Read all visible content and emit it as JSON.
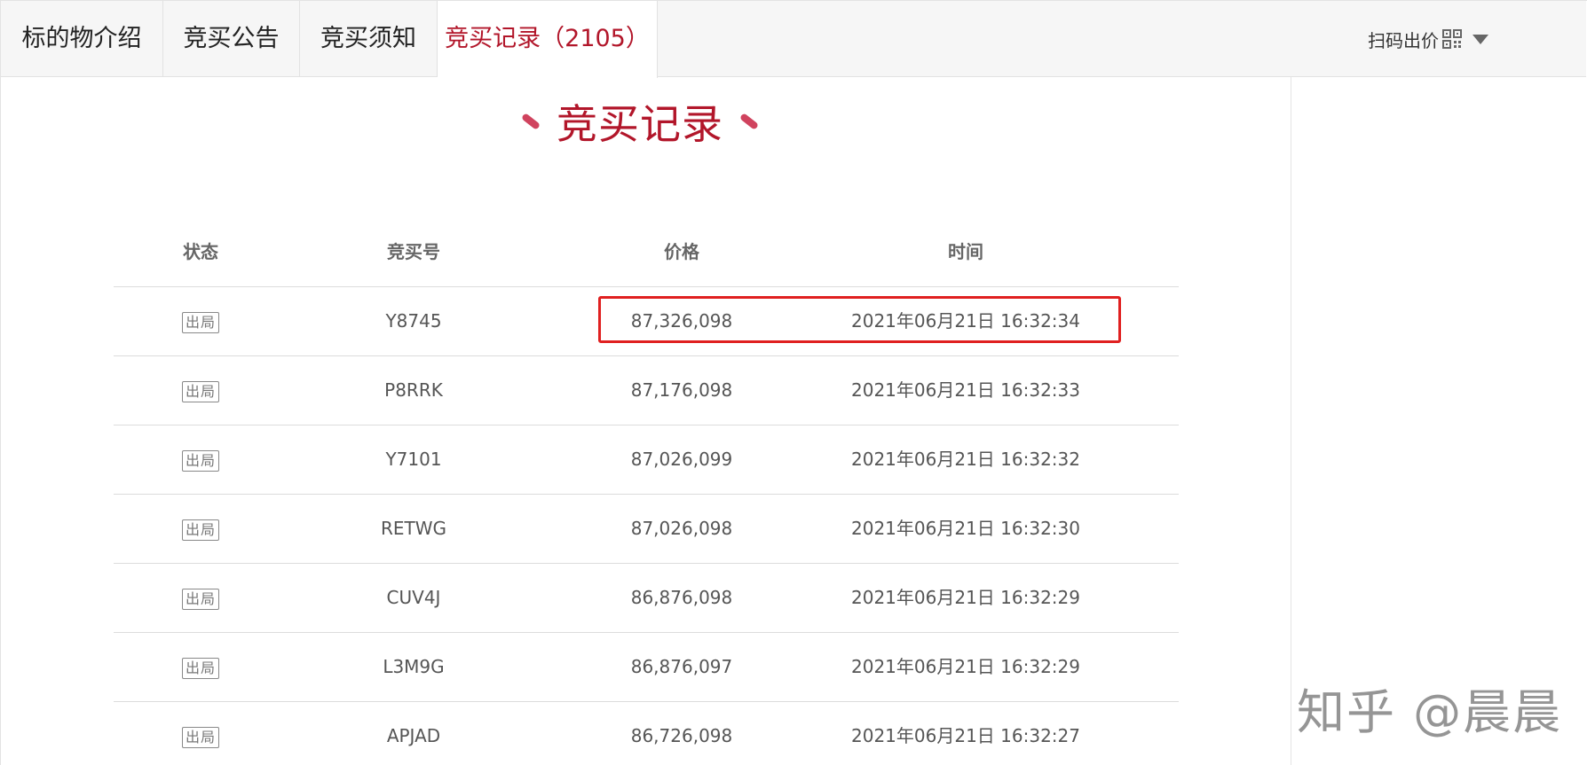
{
  "tabs": [
    {
      "label": "标的物介绍"
    },
    {
      "label": "竞买公告"
    },
    {
      "label": "竞买须知"
    },
    {
      "label": "竞买记录（2105）"
    }
  ],
  "scan_bid": {
    "label": "扫码出价",
    "icon": "qr-code-icon"
  },
  "section_title": "竞买记录",
  "table": {
    "headers": [
      "状态",
      "竞买号",
      "价格",
      "时间"
    ],
    "rows": [
      {
        "status": "出局",
        "bid_no": "Y8745",
        "price": "87,326,098",
        "time": "2021年06月21日 16:32:34"
      },
      {
        "status": "出局",
        "bid_no": "P8RRK",
        "price": "87,176,098",
        "time": "2021年06月21日 16:32:33"
      },
      {
        "status": "出局",
        "bid_no": "Y7101",
        "price": "87,026,099",
        "time": "2021年06月21日 16:32:32"
      },
      {
        "status": "出局",
        "bid_no": "RETWG",
        "price": "87,026,098",
        "time": "2021年06月21日 16:32:30"
      },
      {
        "status": "出局",
        "bid_no": "CUV4J",
        "price": "86,876,098",
        "time": "2021年06月21日 16:32:29"
      },
      {
        "status": "出局",
        "bid_no": "L3M9G",
        "price": "86,876,097",
        "time": "2021年06月21日 16:32:29"
      },
      {
        "status": "出局",
        "bid_no": "APJAD",
        "price": "86,726,098",
        "time": "2021年06月21日 16:32:27"
      }
    ]
  },
  "watermark": "知乎 @晨晨",
  "colors": {
    "accent": "#b2162a",
    "highlight": "#e02020"
  }
}
